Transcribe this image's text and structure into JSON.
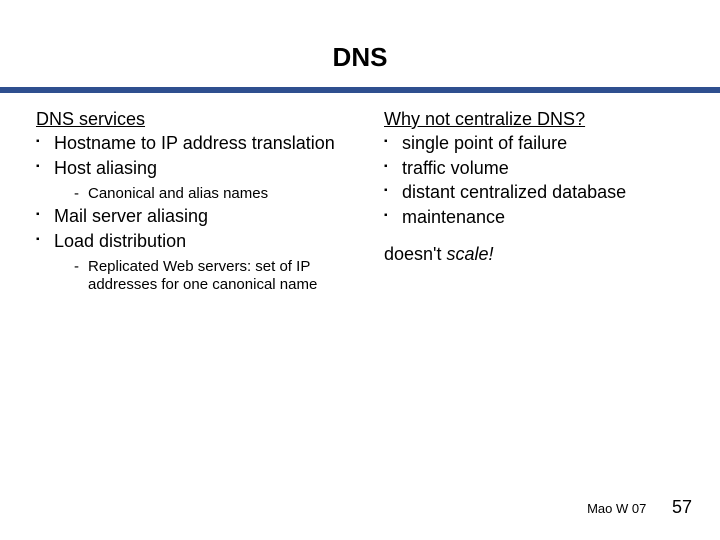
{
  "title": "DNS",
  "left": {
    "heading": "DNS services",
    "items": [
      {
        "text": "Hostname to IP address translation"
      },
      {
        "text": "Host aliasing",
        "sub": [
          "Canonical and alias names"
        ]
      },
      {
        "text": "Mail server aliasing"
      },
      {
        "text": "Load distribution",
        "sub": [
          "Replicated Web servers: set of IP addresses for one canonical name"
        ]
      }
    ]
  },
  "right": {
    "heading": "Why not centralize DNS?",
    "items": [
      {
        "text": "single point of failure"
      },
      {
        "text": "traffic volume"
      },
      {
        "text": "distant centralized database"
      },
      {
        "text": "maintenance"
      }
    ],
    "tail_plain": "doesn't ",
    "tail_em": "scale!"
  },
  "footer": {
    "credit": "Mao W 07",
    "page": "57"
  }
}
